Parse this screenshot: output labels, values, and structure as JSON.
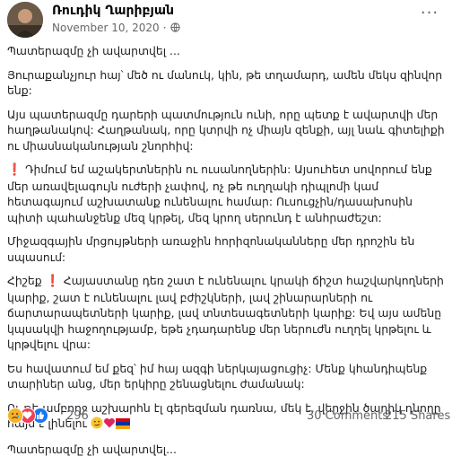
{
  "author": {
    "name": "Ռուդիկ Ղարիբյան"
  },
  "post_meta": {
    "date": "November 10, 2020",
    "separator": "·"
  },
  "post": {
    "p1": "Պատերազմը չի ավարտվել ...",
    "p2": "Յուրաքանչյուր հայ՝ մեծ ու մանուկ, կին, թե տղամարդ, ամեն մեկս զինվոր ենք:",
    "p3": "Այս պատերազմը դարերի պատմություն ունի, որը պետք է ավարտվի մեր հաղթանակով: Հաղթանակ, որը կտրվի ոչ միայն զենքի, այլ նաև գիտելիքի ու միասնականության շնորհիվ:",
    "p4_mark": "❗",
    "p4": " Դիմում եմ աշակերտներին ու ուսանողներին: Այսուհետ սովորում ենք մեր առավելագույն ուժերի չափով, ոչ թե ուղղակի դիպլոմի կամ հետագայում աշխատանք ունենալու համար: Ուսուցչին/դասախոսին պիտի պահանջենք մեզ կրթել, մեզ կրող սերունդ է անհրաժեշտ:",
    "p5": "Միջազգային մրցույթների առաջին հորիզոնականները մեր դրոշին են սպասում:",
    "p6a": "Հիշեք ",
    "p6_mark": "❗",
    "p6b": " Հայաստանը դեռ շատ է ունենալու կրակի ճիշտ հաշվարկողների կարիք, շատ է ունենալու լավ բժիշկների, լավ շինարարների ու ճարտարապետների կարիք, լավ տնտեսագետների կարիք: Եվ այս ամենը կպսակվի հաջողությամբ, եթե չդադարենք մեր ներուժն ուղղել կրթելու և կրթվելու վրա:",
    "p7": "Ես հավատում եմ քեզ՝ իմ հայ ազգի ներկայացուցիչ: Մենք կհանդիպենք տարիներ անց, մեր երկիրը շենացնելու ժամանակ:",
    "p8": "Ու թե ամբողջ աշխարհն էլ գերեզման դառնա, մեկ է, վերջին ծաղիկ դնողը հայն է լինելու ",
    "p9": "Պատերազմը չի ավարտվել..."
  },
  "reactions": {
    "count": "296",
    "types": [
      "sad",
      "love",
      "like"
    ]
  },
  "stats": {
    "comments": "30 Comments",
    "shares": "215 Shares"
  },
  "colors": {
    "accent": "#1877f2",
    "love": "#f33e58",
    "sad": "#f7b125",
    "meta": "#65676b",
    "mark": "#e02424"
  },
  "icons": {
    "globe": "globe-icon",
    "more": "more-options-icon"
  }
}
